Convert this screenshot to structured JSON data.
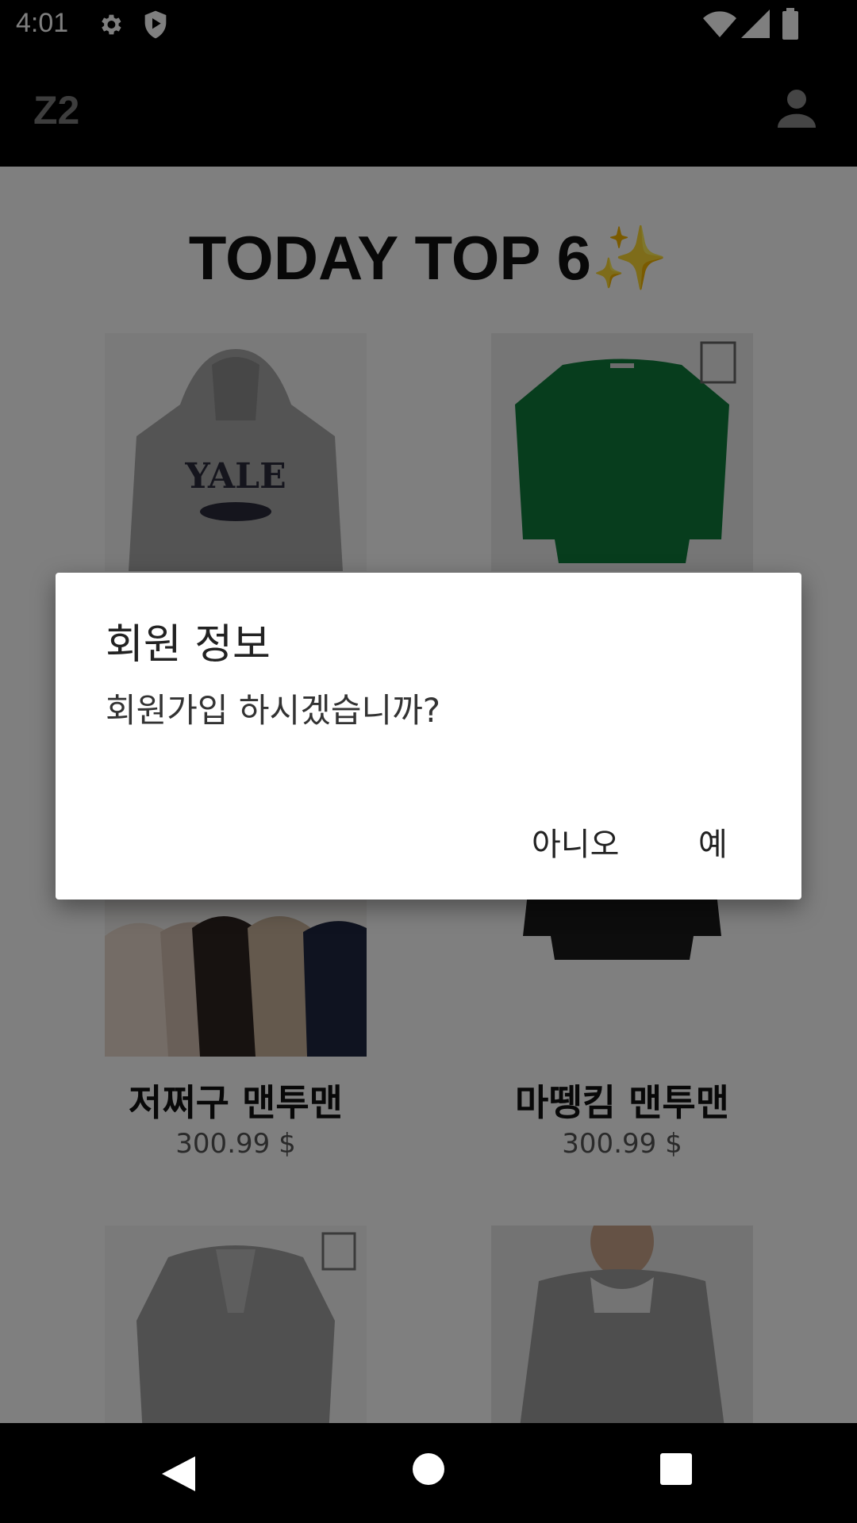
{
  "status_bar": {
    "time": "4:01"
  },
  "app_bar": {
    "title": "Z2",
    "account_icon": "account-circle-icon"
  },
  "main": {
    "section_title": "TODAY TOP 6",
    "section_emoji": "✨",
    "products": [
      {
        "name": "",
        "price": ""
      },
      {
        "name": "",
        "price": ""
      },
      {
        "name": "저쩌구 맨투맨",
        "price": "300.99 $"
      },
      {
        "name": "마뗑킴 맨투맨",
        "price": "300.99 $"
      },
      {
        "name": "",
        "price": ""
      },
      {
        "name": "",
        "price": ""
      }
    ]
  },
  "dialog": {
    "title": "회원 정보",
    "message": "회원가입 하시겠습니까?",
    "negative_label": "아니오",
    "positive_label": "예"
  },
  "colors": {
    "scrim": "#00000080",
    "dialog_bg": "#ffffff",
    "app_bar": "#000000"
  }
}
